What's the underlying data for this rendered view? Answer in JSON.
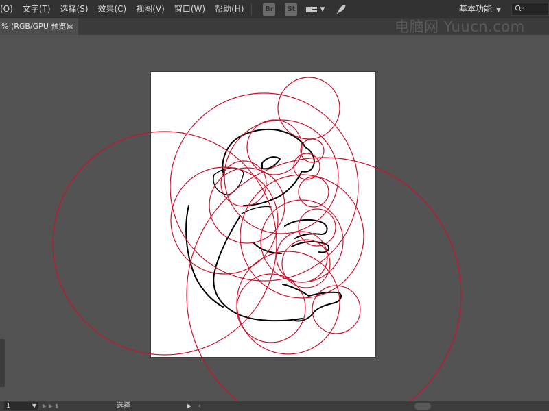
{
  "menu": {
    "items": [
      "(O)",
      "文字(T)",
      "选择(S)",
      "效果(C)",
      "视图(V)",
      "窗口(W)",
      "帮助(H)"
    ],
    "bridge_icon": "Br",
    "stock_icon": "St",
    "layout_icon": "arrange-documents-icon",
    "feather_icon": "gpu-feather-icon",
    "workspace": "基本功能",
    "search_icon": "search-icon"
  },
  "tab": {
    "title": "% (RGB/GPU 预览)",
    "close": "×"
  },
  "watermark": "电脑网 Yuucn.com",
  "artboard": {
    "stroke_color": "#d0102a",
    "sketch_color": "#000000"
  },
  "status": {
    "page": "1",
    "tool": "选择"
  }
}
